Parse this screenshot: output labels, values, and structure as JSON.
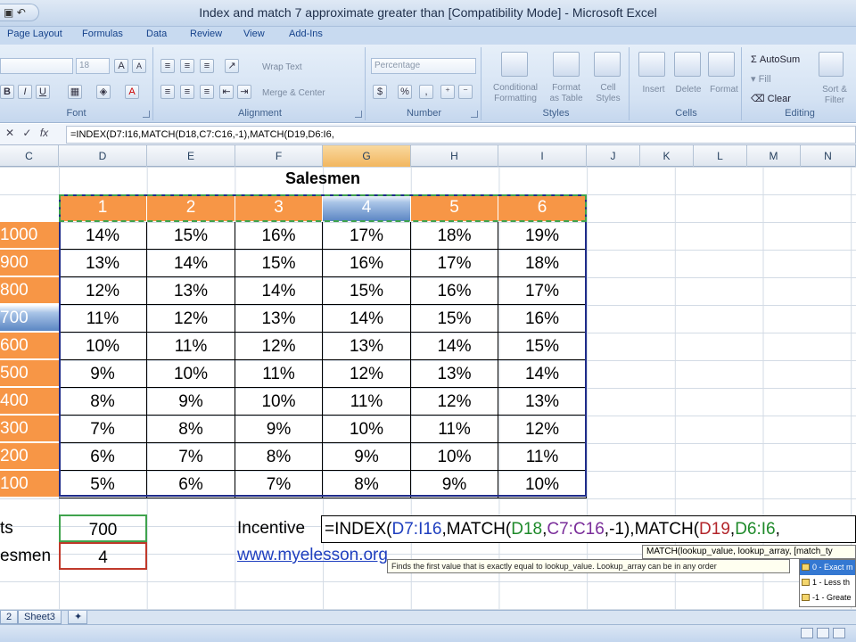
{
  "window": {
    "title": "Index and match 7 approximate greater than  [Compatibility Mode] - Microsoft Excel",
    "qat_icons": [
      "save-icon",
      "undo-icon"
    ]
  },
  "ribbon": {
    "tabs": [
      "Page Layout",
      "Formulas",
      "Data",
      "Review",
      "View",
      "Add-Ins"
    ],
    "font": {
      "size": "18",
      "label": "Font",
      "grow": "A",
      "shrink": "A",
      "bold": "B",
      "italic": "I",
      "underline": "U",
      "color": "A"
    },
    "alignment": {
      "wrap_text": "Wrap Text",
      "merge_center": "Merge & Center",
      "label": "Alignment"
    },
    "number": {
      "format": "Percentage",
      "currency": "$",
      "percent": "%",
      "comma": ",",
      "label": "Number"
    },
    "styles": {
      "conditional": [
        "Conditional",
        "Formatting"
      ],
      "format_table": [
        "Format",
        "as Table"
      ],
      "cell_styles": [
        "Cell",
        "Styles"
      ],
      "label": "Styles"
    },
    "cells": {
      "insert": "Insert",
      "delete": "Delete",
      "format": "Format",
      "label": "Cells"
    },
    "editing": {
      "autosum": "AutoSum",
      "fill": "Fill",
      "clear": "Clear",
      "sort": [
        "Sort &",
        "Filter"
      ],
      "label": "Editing"
    }
  },
  "formula_bar": {
    "fx": "fx",
    "content": "=INDEX(D7:I16,MATCH(D18,C7:C16,-1),MATCH(D19,D6:I6,"
  },
  "columns": [
    "C",
    "D",
    "E",
    "F",
    "G",
    "H",
    "I",
    "J",
    "K",
    "L",
    "M",
    "N"
  ],
  "sheet": {
    "title": "Salesmen",
    "header_values": [
      "1",
      "2",
      "3",
      "4",
      "5",
      "6"
    ],
    "row_labels": [
      "1000",
      "900",
      "800",
      "700",
      "600",
      "500",
      "400",
      "300",
      "200",
      "100"
    ],
    "values": [
      [
        "14%",
        "15%",
        "16%",
        "17%",
        "18%",
        "19%"
      ],
      [
        "13%",
        "14%",
        "15%",
        "16%",
        "17%",
        "18%"
      ],
      [
        "12%",
        "13%",
        "14%",
        "15%",
        "16%",
        "17%"
      ],
      [
        "11%",
        "12%",
        "13%",
        "14%",
        "15%",
        "16%"
      ],
      [
        "10%",
        "11%",
        "12%",
        "13%",
        "14%",
        "15%"
      ],
      [
        "9%",
        "10%",
        "11%",
        "12%",
        "13%",
        "14%"
      ],
      [
        "8%",
        "9%",
        "10%",
        "11%",
        "12%",
        "13%"
      ],
      [
        "7%",
        "8%",
        "9%",
        "10%",
        "11%",
        "12%"
      ],
      [
        "6%",
        "7%",
        "8%",
        "9%",
        "10%",
        "11%"
      ],
      [
        "5%",
        "6%",
        "7%",
        "8%",
        "9%",
        "10%"
      ]
    ],
    "input_labels": [
      "ts",
      "esmen"
    ],
    "inputs": [
      "700",
      "4"
    ],
    "incentive_label": "Incentive",
    "edit_formula_parts": [
      {
        "text": "=INDEX(",
        "color": "black"
      },
      {
        "text": "D7:I16",
        "color": "blue"
      },
      {
        "text": ",MATCH(",
        "color": "black"
      },
      {
        "text": "D18",
        "color": "green"
      },
      {
        "text": ",",
        "color": "black"
      },
      {
        "text": "C7:C16",
        "color": "purple"
      },
      {
        "text": ",-1),MATCH(",
        "color": "black"
      },
      {
        "text": "D19",
        "color": "red"
      },
      {
        "text": ",",
        "color": "black"
      },
      {
        "text": "D6:I6",
        "color": "green"
      },
      {
        "text": ",",
        "color": "black"
      }
    ],
    "link": "www.myelesson.org"
  },
  "tooltips": {
    "signature": "MATCH(lookup_value, lookup_array, [match_ty",
    "description": "Finds the first value that is exactly equal to lookup_value. Lookup_array can be in any order",
    "options": [
      "0 - Exact m",
      "1 - Less th",
      "-1 - Greate"
    ]
  },
  "sheet_tabs": [
    "2",
    "Sheet3"
  ]
}
